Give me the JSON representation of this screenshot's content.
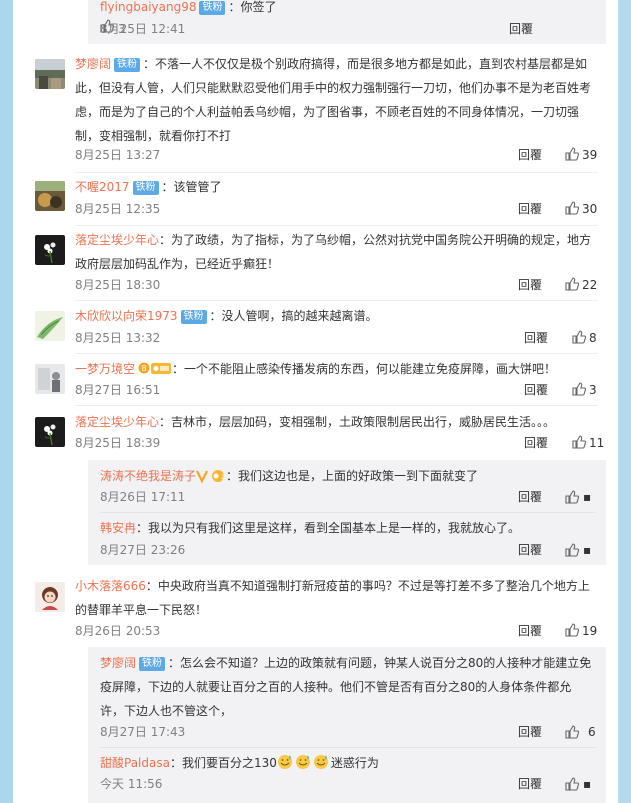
{
  "labels": {
    "reply": "回覆",
    "badge": "铁粉"
  },
  "colors": {
    "username": "#eb7350",
    "badge": "#5da9e6",
    "background": "#acd6ec"
  },
  "top_reply": {
    "user": "flyingbaiyang98",
    "text": "：你签了",
    "time": "8月25日 12:41",
    "likes": "3"
  },
  "comments": [
    {
      "user": "梦廖阔",
      "badge": true,
      "text": "：不落一人不仅仅是极个别政府搞得，而是很多地方都是如此，直到农村基层都是如此，但没有人管，人们只能默默忍受他们用手中的权力强制强行一刀切，他们办事不是为老百姓考虑，而是为了自己的个人利益帕丢乌纱帽，为了图省事，不顾老百姓的不同身体情况，一刀切强制，变相强制，就看你打不打",
      "time": "8月25日 13:27",
      "likes": "39"
    },
    {
      "user": "不喔2017",
      "badge": true,
      "text": "：该管管了",
      "time": "8月25日 12:35",
      "likes": "30"
    },
    {
      "user": "落定尘埃少年心",
      "badge": false,
      "text": "：为了政绩，为了指标，为了乌纱帽，公然对抗党中国务院公开明确的规定，地方政府层层加码乱作为，已经近乎癫狂！",
      "time": "8月25日 18:30",
      "likes": "22"
    },
    {
      "user": "木欣欣以向荣1973",
      "badge": true,
      "text": "：没人管啊，搞的越来越离谱。",
      "time": "8月25日 13:32",
      "likes": "8"
    },
    {
      "user": "一梦万境空",
      "badge": false,
      "text": "：一个不能阻止感染传播发病的东西，何以能建立免疫屏障，画大饼吧！",
      "time": "8月27日 16:51",
      "likes": "3"
    },
    {
      "user": "落定尘埃少年心",
      "badge": false,
      "text": "：吉林市，层层加码，变相强制，土政策限制居民出行，威胁居民生活。。。",
      "time": "8月25日 18:39",
      "likes": "11",
      "replies": [
        {
          "user": "涛涛不绝我是涛子",
          "text": "：我们这边也是，上面的好政策一到下面就变了",
          "time": "8月26日 17:11"
        },
        {
          "user": "韩安冉",
          "text": "：我以为只有我们这里是这样，看到全国基本上是一样的，我就放心了。",
          "time": "8月27日 23:26"
        }
      ]
    },
    {
      "user": "小木落落666",
      "badge": false,
      "text": "：中央政府当真不知道强制打新冠疫苗的事吗？不过是等打差不多了整治几个地方上的替罪羊平息一下民怒！",
      "time": "8月26日 20:53",
      "likes": "19",
      "replies": [
        {
          "user": "梦廖阔",
          "badge": true,
          "text": "：怎么会不知道？上边的政策就有问题，钟某人说百分之80的人接种才能建立免疫屏障，下边的人就要让百分之百的人接种。他们不管是否有百分之80的人身体条件都允许，下边人也不管这个，",
          "time": "8月27日 17:43",
          "likes": "6"
        },
        {
          "user": "甜酸Paldasa",
          "text": "：我们要百分之130",
          "text_suffix": "迷惑行为",
          "time": "今天 11:56"
        }
      ]
    }
  ]
}
